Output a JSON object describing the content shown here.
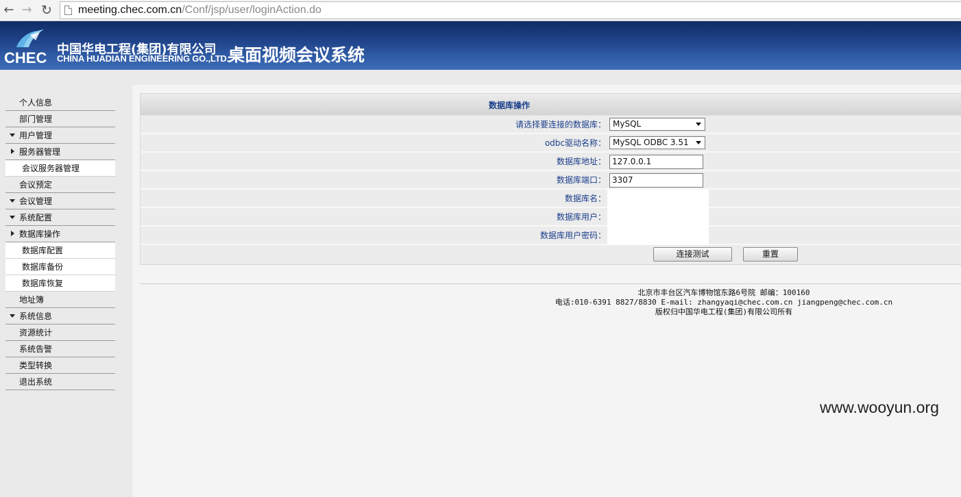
{
  "browser": {
    "url_host": "meeting.chec.com.cn",
    "url_path": "/Conf/jsp/user/loginAction.do"
  },
  "header": {
    "logo_text": "CHEC",
    "company_cn": "中国华电工程(集团)有限公司",
    "company_en": "CHINA HUADIAN ENGINEERING GO.,LTD.",
    "system_title": "桌面视频会议系统",
    "colors": {
      "banner_top": "#0f2c66",
      "banner_bottom": "#3d6db8"
    }
  },
  "sidebar": {
    "items": [
      {
        "label": "个人信息",
        "arrow": ""
      },
      {
        "label": "部门管理",
        "arrow": ""
      },
      {
        "label": "用户管理",
        "arrow": "down"
      },
      {
        "label": "服务器管理",
        "arrow": "right"
      },
      {
        "label": "会议服务器管理",
        "sub": true
      },
      {
        "label": "会议预定",
        "arrow": ""
      },
      {
        "label": "会议管理",
        "arrow": "down"
      },
      {
        "label": "系统配置",
        "arrow": "down"
      },
      {
        "label": "数据库操作",
        "arrow": "right"
      },
      {
        "label": "数据库配置",
        "sub": true
      },
      {
        "label": "数据库备份",
        "sub": true
      },
      {
        "label": "数据库恢复",
        "sub": true
      },
      {
        "label": "地址簿",
        "arrow": ""
      },
      {
        "label": "系统信息",
        "arrow": "down"
      },
      {
        "label": "资源统计",
        "arrow": ""
      },
      {
        "label": "系统告警",
        "arrow": ""
      },
      {
        "label": "类型转换",
        "arrow": ""
      },
      {
        "label": "退出系统",
        "arrow": ""
      }
    ]
  },
  "form": {
    "title": "数据库操作",
    "db_select_label": "请选择要连接的数据库：",
    "db_select_value": "MySQL",
    "odbc_label": "odbc驱动名称：",
    "odbc_value": "MySQL ODBC 3.51",
    "host_label": "数据库地址：",
    "host_value": "127.0.0.1",
    "port_label": "数据库端口：",
    "port_value": "3307",
    "dbname_label": "数据库名：",
    "dbuser_label": "数据库用户：",
    "dbpass_label": "数据库用户密码：",
    "test_button": "连接测试",
    "reset_button": "重置"
  },
  "footer": {
    "address": "北京市丰台区汽车博物馆东路6号院 邮编：100160",
    "contact": "电话:010-6391 8827/8830 E-mail: zhangyaqi@chec.com.cn jiangpeng@chec.com.cn",
    "copyright": "版权归中国华电工程(集团)有限公司所有"
  },
  "watermark": "www.wooyun.org"
}
